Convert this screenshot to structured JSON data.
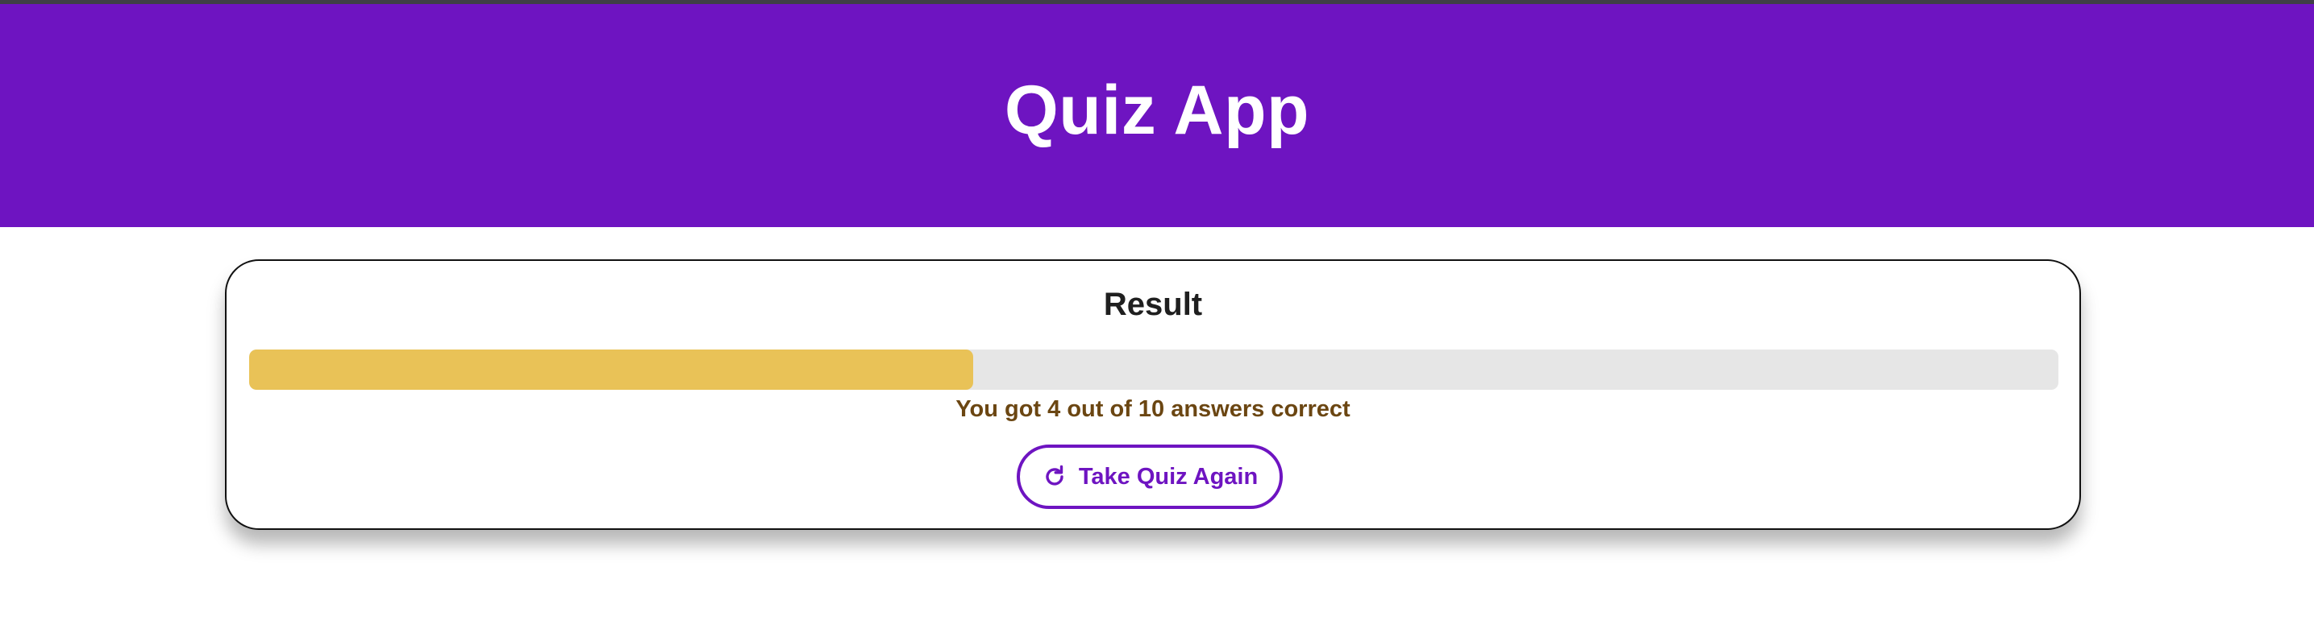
{
  "header": {
    "title": "Quiz App"
  },
  "result": {
    "heading": "Result",
    "correct": 4,
    "total": 10,
    "progress_fraction": 0.4,
    "message": "You got 4 out of 10 answers correct",
    "button_label": "Take Quiz Again",
    "button_icon": "refresh-icon"
  },
  "colors": {
    "brand": "#6e14c1",
    "progress_fill": "#e9c257",
    "progress_track": "#e6e6e6",
    "message_text": "#6b4612"
  }
}
